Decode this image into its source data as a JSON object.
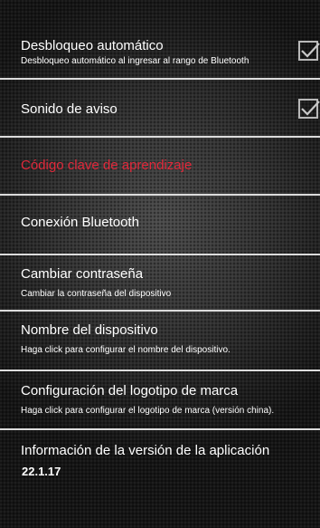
{
  "settings": {
    "auto_unlock": {
      "title": "Desbloqueo automático",
      "subtitle": "Desbloqueo automático al ingresar al rango de Bluetooth",
      "checked": true
    },
    "warning_sound": {
      "title": "Sonido de aviso",
      "checked": true
    },
    "learning_key": {
      "title": "Código clave de aprendizaje",
      "color": "#e0283a"
    },
    "bluetooth": {
      "title": "Conexión Bluetooth"
    },
    "change_password": {
      "title": "Cambiar contraseña",
      "subtitle": "Cambiar la contraseña del dispositivo"
    },
    "device_name": {
      "title": "Nombre del dispositivo",
      "subtitle": "Haga click para configurar el nombre del dispositivo."
    },
    "brand_logo": {
      "title": "Configuración del logotipo de marca",
      "subtitle": "Haga click para configurar el logotipo de marca (versión china)."
    },
    "app_version": {
      "title": "Información de la versión de la aplicación",
      "value": "22.1.17"
    }
  },
  "icons": {
    "checkbox_checked": "checkmark-icon"
  },
  "colors": {
    "divider": "#dcdcdc",
    "accent_red": "#e0283a",
    "checkbox_border": "#b9b9b9"
  }
}
